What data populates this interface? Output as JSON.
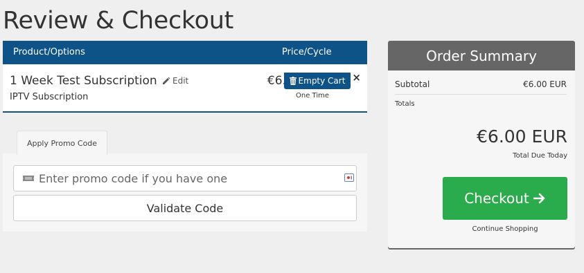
{
  "page": {
    "title": "Review & Checkout"
  },
  "cart": {
    "header": {
      "product_options": "Product/Options",
      "price_cycle": "Price/Cycle"
    },
    "items": [
      {
        "name": "1 Week Test Subscription",
        "edit_label": "Edit",
        "group": "IPTV Subscription",
        "price": "€6.00 EUR",
        "cycle": "One Time",
        "remove_icon": "×"
      }
    ],
    "empty_cart_label": "Empty Cart"
  },
  "promo": {
    "tab_label": "Apply Promo Code",
    "input_value": "",
    "input_placeholder": "Enter promo code if you have one",
    "validate_label": "Validate Code"
  },
  "summary": {
    "title": "Order Summary",
    "subtotal_label": "Subtotal",
    "subtotal_value": "€6.00 EUR",
    "totals_label": "Totals",
    "total_due": "€6.00 EUR",
    "total_due_label": "Total Due Today",
    "checkout_label": "Checkout",
    "continue_label": "Continue Shopping"
  },
  "colors": {
    "header_blue": "#0d5388",
    "summary_header_gray": "#666666",
    "checkout_green": "#2aab4c",
    "page_bg": "#efefef"
  },
  "icons": [
    "pencil-icon",
    "trash-icon",
    "ticket-icon",
    "field-lock-icon",
    "arrow-right-icon",
    "close-icon"
  ]
}
